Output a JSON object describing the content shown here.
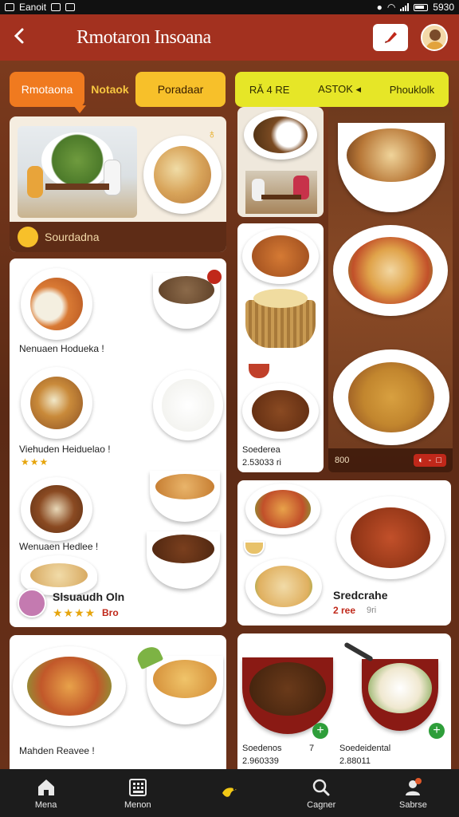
{
  "status_bar": {
    "left_text": "Eanoit",
    "right_text": "5930"
  },
  "header": {
    "title": "Rmotaron Insoana"
  },
  "tabs": [
    {
      "label": "Rmotaona"
    },
    {
      "label": "Notaok"
    },
    {
      "label": "Poradaar"
    },
    {
      "labels": [
        "RǍ 4 RE",
        "ASTOK ◂",
        "Phouklolk"
      ]
    }
  ],
  "cards": {
    "featured": {
      "label": "Sourdadna"
    },
    "menu_items": [
      {
        "name": "Nenuaen Hodueka !"
      },
      {
        "name": "Viehuden Heiduelao !",
        "stars": "★★★"
      },
      {
        "name": "Wenuaen Hedlee !"
      }
    ],
    "promo": {
      "name": "Slsuaudh Oln",
      "stars": "★★★★",
      "rating": "Bro"
    },
    "bottom_left": {
      "name": "Mahden Reavee !"
    },
    "middle_col": {
      "name": "Soederea",
      "price": "2.53033 ri"
    },
    "right_photo": {
      "price": "800"
    },
    "right_card": {
      "name": "Sredcrahe",
      "price": "2 ree",
      "sub": "9ri"
    },
    "bottom_right": [
      {
        "name": "Soedenos",
        "mark": "7",
        "price": "2.960339"
      },
      {
        "name": "Soedeidental",
        "price": "2.88011"
      }
    ]
  },
  "bottom_nav": [
    {
      "label": "Mena",
      "icon": "home-icon"
    },
    {
      "label": "Menon",
      "icon": "grid-icon"
    },
    {
      "label": "",
      "icon": "bird-icon"
    },
    {
      "label": "Cagner",
      "icon": "search-icon"
    },
    {
      "label": "Sabrse",
      "icon": "user-icon"
    }
  ],
  "colors": {
    "header": "#a3311f",
    "accent_orange": "#f07a1f",
    "accent_yellow": "#f7c02a",
    "accent_lime": "#e6e627",
    "nav": "#1c1c1c"
  }
}
